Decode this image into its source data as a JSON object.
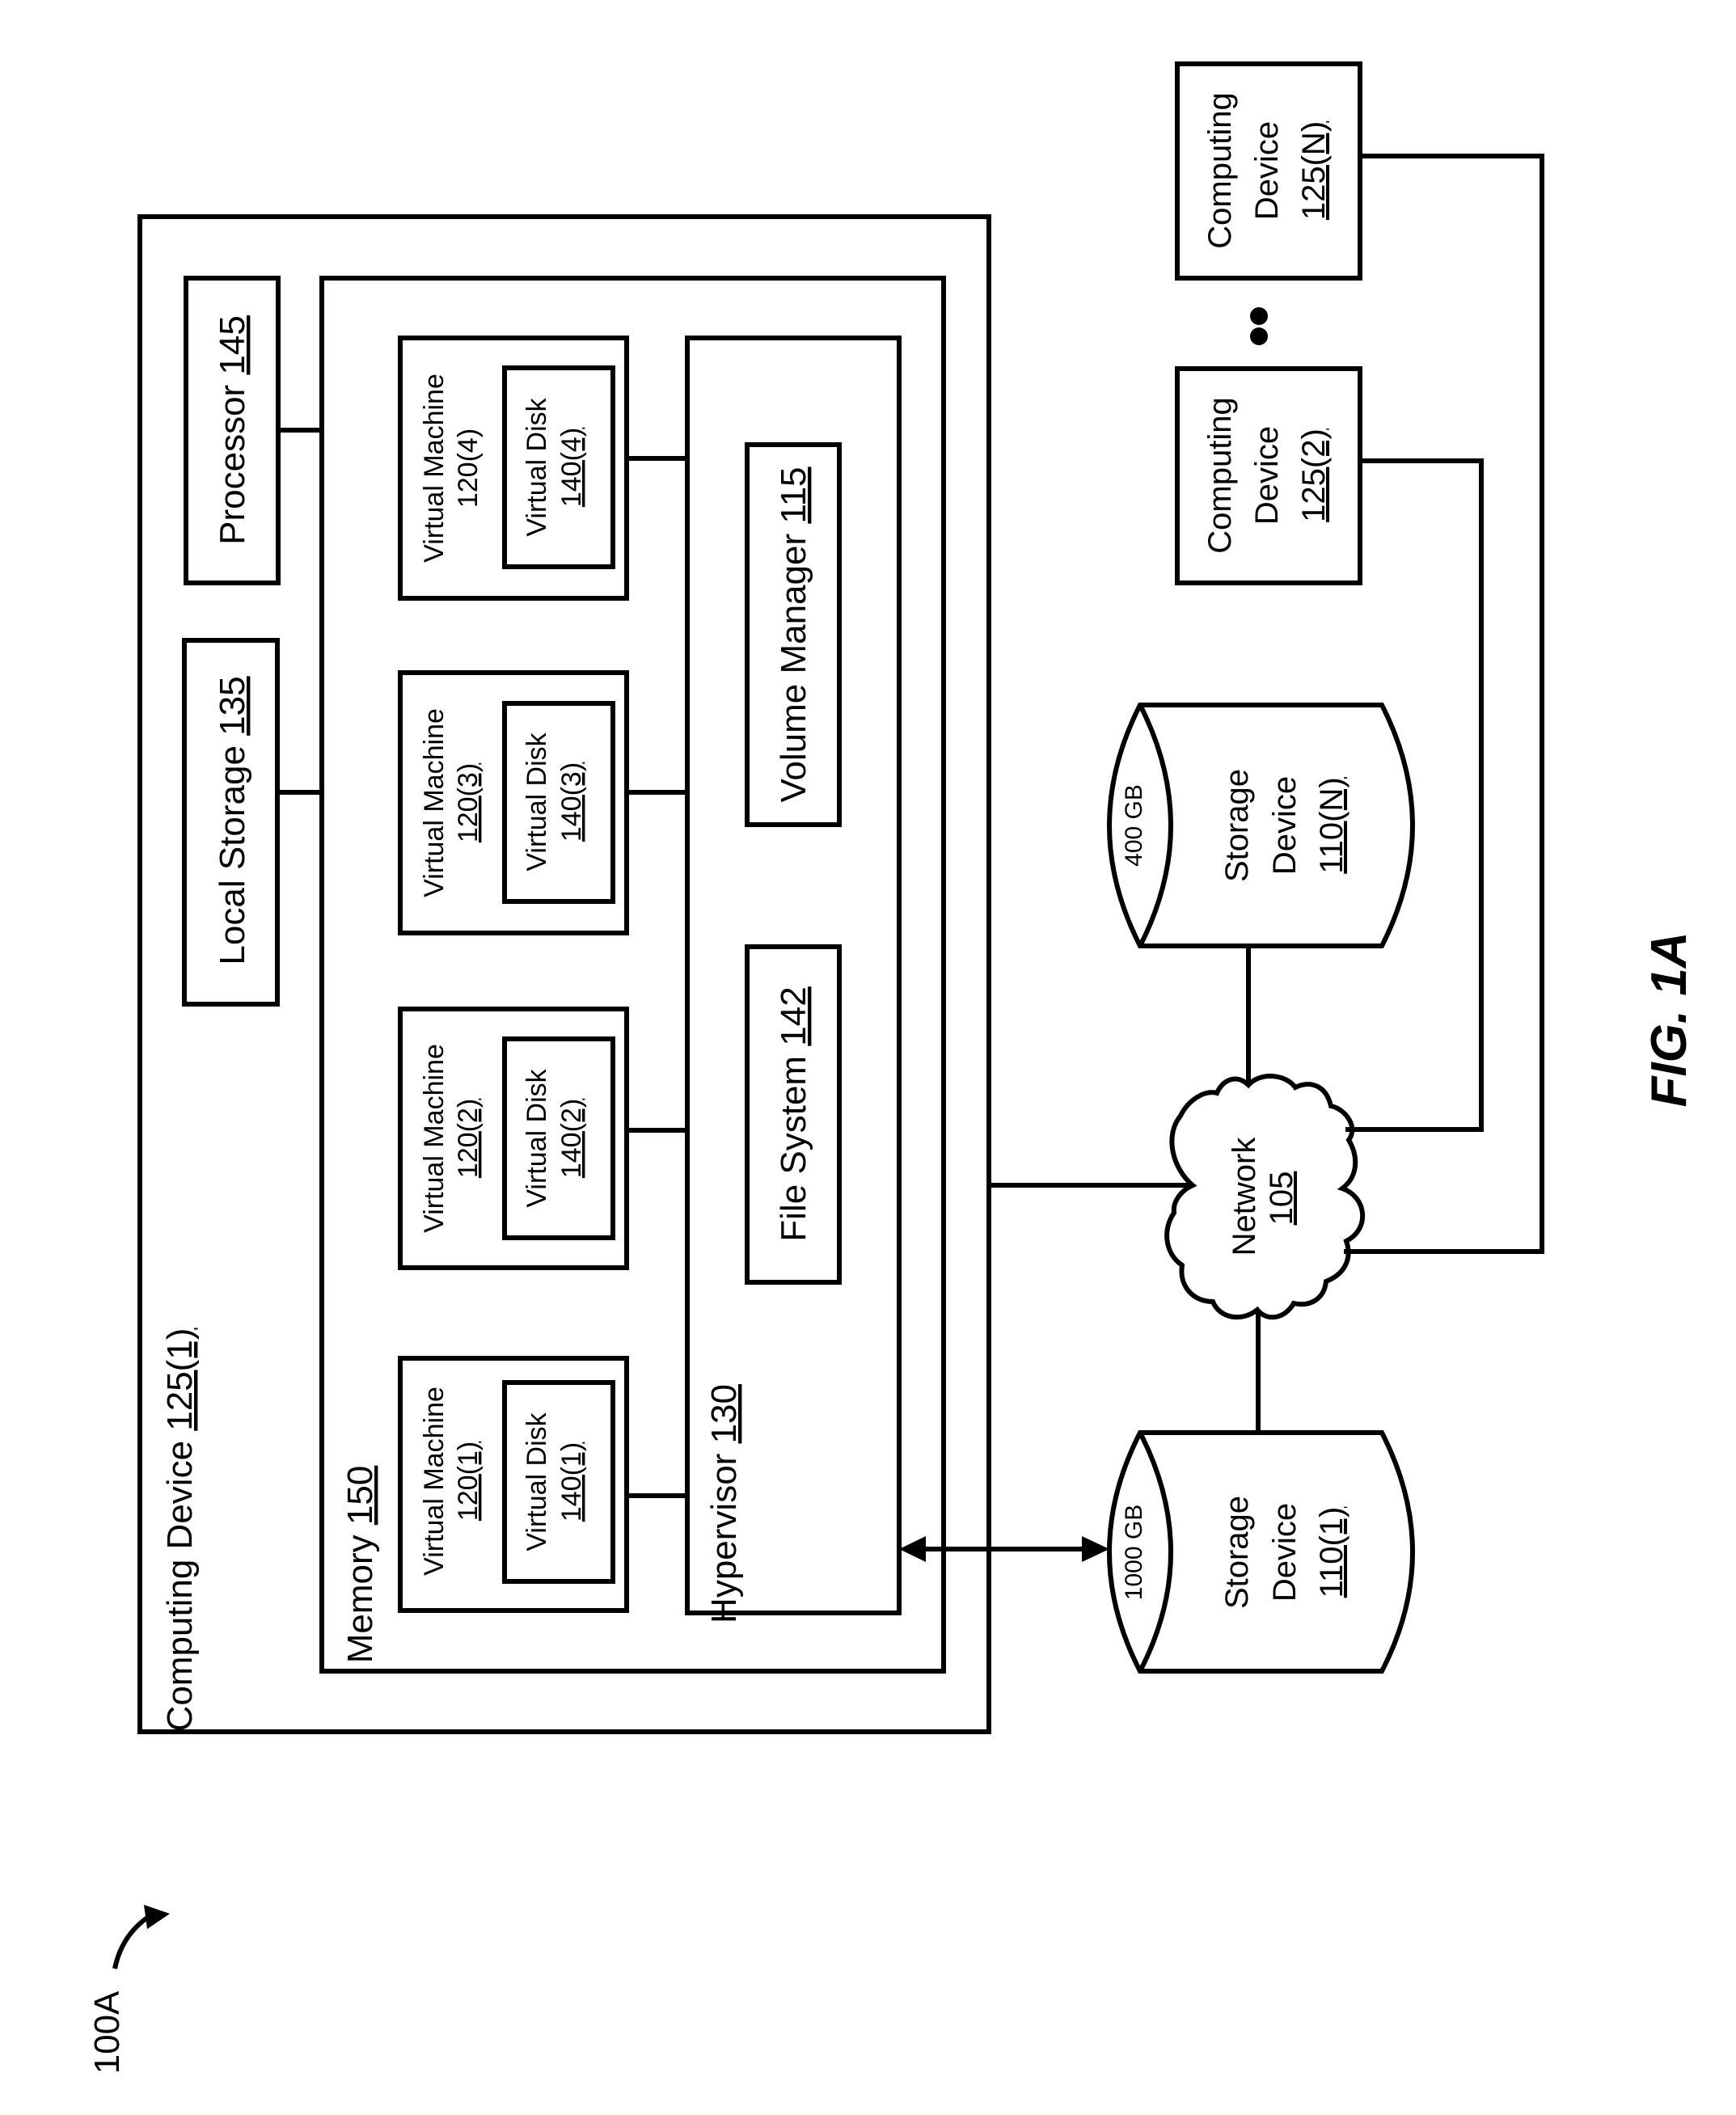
{
  "figure": {
    "label": "FIG. 1A",
    "reference": "100A"
  },
  "computing_device_main": {
    "label": "Computing Device ",
    "ref": "125(1)",
    "processor": {
      "label": "Processor ",
      "ref": "145"
    },
    "local_storage": {
      "label": "Local Storage ",
      "ref": "135"
    },
    "memory": {
      "label": "Memory ",
      "ref": "150",
      "virtual_machines": [
        {
          "label": "Virtual Machine",
          "ref": "120(1)",
          "disk_label": "Virtual Disk",
          "disk_ref": "140(1)"
        },
        {
          "label": "Virtual Machine",
          "ref": "120(2)",
          "disk_label": "Virtual Disk",
          "disk_ref": "140(2)"
        },
        {
          "label": "Virtual Machine",
          "ref": "120(3)",
          "disk_label": "Virtual Disk",
          "disk_ref": "140(3)"
        },
        {
          "label": "Virtual Machine",
          "ref": "120(4)",
          "disk_label": "Virtual Disk",
          "disk_ref": "140(4)"
        }
      ],
      "hypervisor": {
        "label": "Hypervisor ",
        "ref": "130",
        "file_system": {
          "label": "File System ",
          "ref": "142"
        },
        "volume_manager": {
          "label": "Volume Manager ",
          "ref": "115"
        }
      }
    }
  },
  "network": {
    "label": "Network",
    "ref": "105"
  },
  "storage_devices": [
    {
      "label_line1": "Storage",
      "label_line2": "Device",
      "ref": "110(1)",
      "capacity": "1000 GB"
    },
    {
      "label_line1": "Storage",
      "label_line2": "Device",
      "ref": "110(N)",
      "capacity": "400 GB"
    }
  ],
  "other_computing_devices": [
    {
      "label_line1": "Computing",
      "label_line2": "Device",
      "ref": "125(2)"
    },
    {
      "label_line1": "Computing",
      "label_line2": "Device",
      "ref": "125(N)"
    }
  ],
  "ellipsis": "••"
}
